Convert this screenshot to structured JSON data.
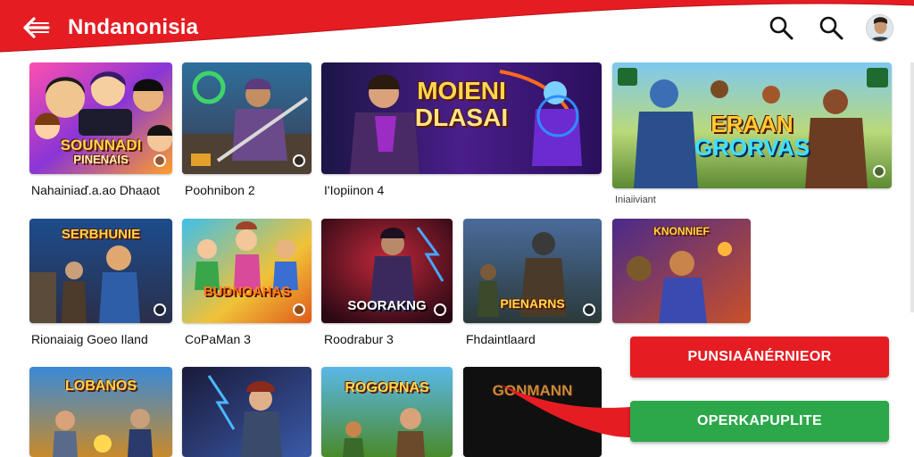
{
  "header": {
    "brand": "Nndanonisia",
    "accent": "#e51d23",
    "icons": [
      "back-arrow-icon",
      "search-icon",
      "search-icon",
      "avatar"
    ]
  },
  "tiles": [
    {
      "title_line1": "SOUNNADI",
      "title_line2": "PINENAIS",
      "label": "Nahainiaď.a.ao Dhaaot",
      "sublabel": ""
    },
    {
      "title_line1": "",
      "title_line2": "",
      "label": "Poohnibon 2",
      "sublabel": ""
    },
    {
      "title_line1": "MOIENI",
      "title_line2": "DLASAI",
      "label": "I'Iopiinon 4",
      "sublabel": ""
    },
    {
      "title_line1": "ERAAN",
      "title_line2": "GRORVAS",
      "label": "",
      "sublabel": "Iniaiiviant"
    },
    {
      "title_line1": "SERBHUNIE",
      "title_line2": "",
      "label": "Rionaiaig Goeo Iland",
      "sublabel": ""
    },
    {
      "title_line1": "BUDNOAHAS",
      "title_line2": "",
      "label": "CoPaMan 3",
      "sublabel": ""
    },
    {
      "title_line1": "SOORAKNG",
      "title_line2": "",
      "label": "Roodrabur 3",
      "sublabel": ""
    },
    {
      "title_line1": "PIENARNS",
      "title_line2": "",
      "label": "Fhdaintlaard",
      "sublabel": ""
    },
    {
      "title_line1": "KNONNIEF",
      "title_line2": "",
      "label": "",
      "sublabel": ""
    },
    {
      "title_line1": "LOBANOS",
      "title_line2": "",
      "label": "",
      "sublabel": ""
    },
    {
      "title_line1": "",
      "title_line2": "",
      "label": "",
      "sublabel": ""
    },
    {
      "title_line1": "ROGORNAS",
      "title_line2": "",
      "label": "",
      "sublabel": ""
    },
    {
      "title_line1": "GONMANN",
      "title_line2": "",
      "label": "",
      "sublabel": ""
    }
  ],
  "buttons": {
    "primary": "PUNSIAÁNÉRNIEOR",
    "secondary": "OPERKAPUPLITE"
  }
}
